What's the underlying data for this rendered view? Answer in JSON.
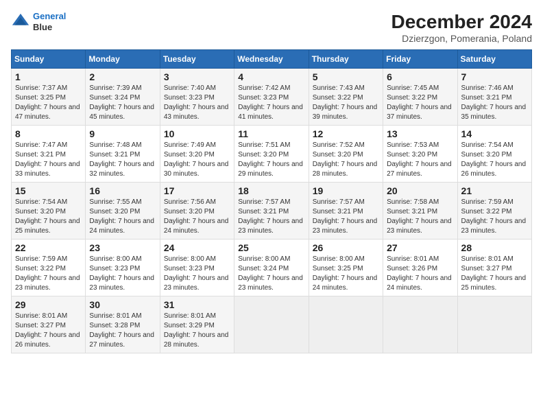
{
  "logo": {
    "line1": "General",
    "line2": "Blue"
  },
  "title": "December 2024",
  "subtitle": "Dzierzgon, Pomerania, Poland",
  "weekdays": [
    "Sunday",
    "Monday",
    "Tuesday",
    "Wednesday",
    "Thursday",
    "Friday",
    "Saturday"
  ],
  "weeks": [
    [
      {
        "day": "1",
        "sunrise": "7:37 AM",
        "sunset": "3:25 PM",
        "daylight": "7 hours and 47 minutes."
      },
      {
        "day": "2",
        "sunrise": "7:39 AM",
        "sunset": "3:24 PM",
        "daylight": "7 hours and 45 minutes."
      },
      {
        "day": "3",
        "sunrise": "7:40 AM",
        "sunset": "3:23 PM",
        "daylight": "7 hours and 43 minutes."
      },
      {
        "day": "4",
        "sunrise": "7:42 AM",
        "sunset": "3:23 PM",
        "daylight": "7 hours and 41 minutes."
      },
      {
        "day": "5",
        "sunrise": "7:43 AM",
        "sunset": "3:22 PM",
        "daylight": "7 hours and 39 minutes."
      },
      {
        "day": "6",
        "sunrise": "7:45 AM",
        "sunset": "3:22 PM",
        "daylight": "7 hours and 37 minutes."
      },
      {
        "day": "7",
        "sunrise": "7:46 AM",
        "sunset": "3:21 PM",
        "daylight": "7 hours and 35 minutes."
      }
    ],
    [
      {
        "day": "8",
        "sunrise": "7:47 AM",
        "sunset": "3:21 PM",
        "daylight": "7 hours and 33 minutes."
      },
      {
        "day": "9",
        "sunrise": "7:48 AM",
        "sunset": "3:21 PM",
        "daylight": "7 hours and 32 minutes."
      },
      {
        "day": "10",
        "sunrise": "7:49 AM",
        "sunset": "3:20 PM",
        "daylight": "7 hours and 30 minutes."
      },
      {
        "day": "11",
        "sunrise": "7:51 AM",
        "sunset": "3:20 PM",
        "daylight": "7 hours and 29 minutes."
      },
      {
        "day": "12",
        "sunrise": "7:52 AM",
        "sunset": "3:20 PM",
        "daylight": "7 hours and 28 minutes."
      },
      {
        "day": "13",
        "sunrise": "7:53 AM",
        "sunset": "3:20 PM",
        "daylight": "7 hours and 27 minutes."
      },
      {
        "day": "14",
        "sunrise": "7:54 AM",
        "sunset": "3:20 PM",
        "daylight": "7 hours and 26 minutes."
      }
    ],
    [
      {
        "day": "15",
        "sunrise": "7:54 AM",
        "sunset": "3:20 PM",
        "daylight": "7 hours and 25 minutes."
      },
      {
        "day": "16",
        "sunrise": "7:55 AM",
        "sunset": "3:20 PM",
        "daylight": "7 hours and 24 minutes."
      },
      {
        "day": "17",
        "sunrise": "7:56 AM",
        "sunset": "3:20 PM",
        "daylight": "7 hours and 24 minutes."
      },
      {
        "day": "18",
        "sunrise": "7:57 AM",
        "sunset": "3:21 PM",
        "daylight": "7 hours and 23 minutes."
      },
      {
        "day": "19",
        "sunrise": "7:57 AM",
        "sunset": "3:21 PM",
        "daylight": "7 hours and 23 minutes."
      },
      {
        "day": "20",
        "sunrise": "7:58 AM",
        "sunset": "3:21 PM",
        "daylight": "7 hours and 23 minutes."
      },
      {
        "day": "21",
        "sunrise": "7:59 AM",
        "sunset": "3:22 PM",
        "daylight": "7 hours and 23 minutes."
      }
    ],
    [
      {
        "day": "22",
        "sunrise": "7:59 AM",
        "sunset": "3:22 PM",
        "daylight": "7 hours and 23 minutes."
      },
      {
        "day": "23",
        "sunrise": "8:00 AM",
        "sunset": "3:23 PM",
        "daylight": "7 hours and 23 minutes."
      },
      {
        "day": "24",
        "sunrise": "8:00 AM",
        "sunset": "3:23 PM",
        "daylight": "7 hours and 23 minutes."
      },
      {
        "day": "25",
        "sunrise": "8:00 AM",
        "sunset": "3:24 PM",
        "daylight": "7 hours and 23 minutes."
      },
      {
        "day": "26",
        "sunrise": "8:00 AM",
        "sunset": "3:25 PM",
        "daylight": "7 hours and 24 minutes."
      },
      {
        "day": "27",
        "sunrise": "8:01 AM",
        "sunset": "3:26 PM",
        "daylight": "7 hours and 24 minutes."
      },
      {
        "day": "28",
        "sunrise": "8:01 AM",
        "sunset": "3:27 PM",
        "daylight": "7 hours and 25 minutes."
      }
    ],
    [
      {
        "day": "29",
        "sunrise": "8:01 AM",
        "sunset": "3:27 PM",
        "daylight": "7 hours and 26 minutes."
      },
      {
        "day": "30",
        "sunrise": "8:01 AM",
        "sunset": "3:28 PM",
        "daylight": "7 hours and 27 minutes."
      },
      {
        "day": "31",
        "sunrise": "8:01 AM",
        "sunset": "3:29 PM",
        "daylight": "7 hours and 28 minutes."
      },
      null,
      null,
      null,
      null
    ]
  ],
  "labels": {
    "sunrise": "Sunrise:",
    "sunset": "Sunset:",
    "daylight": "Daylight:"
  }
}
